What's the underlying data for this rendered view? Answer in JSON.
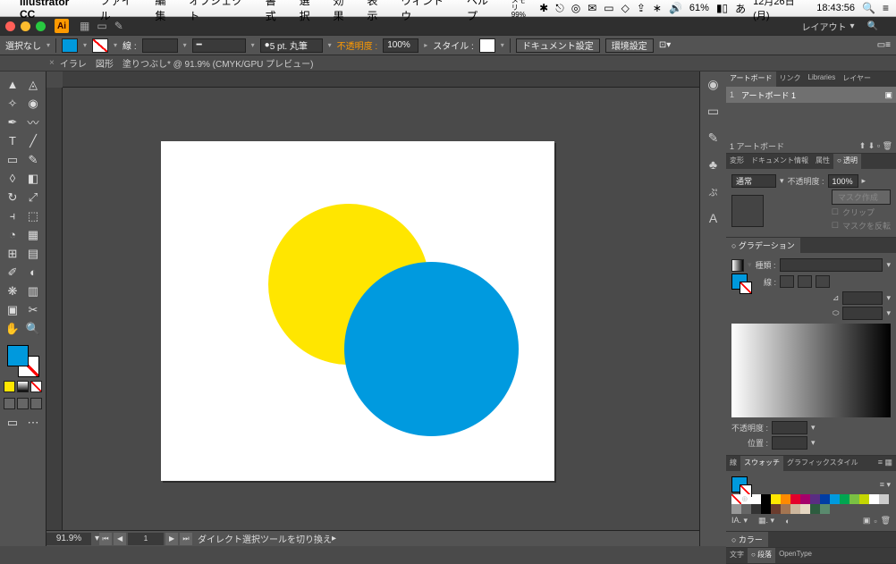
{
  "menubar": {
    "app": "Illustrator CC",
    "items": [
      "ファイル",
      "編集",
      "オブジェクト",
      "書式",
      "選択",
      "効果",
      "表示",
      "ウィンドウ",
      "ヘルプ"
    ],
    "memory_label": "メモリ",
    "memory_pct": "99%",
    "battery": "61%",
    "date": "12月26日(月)",
    "time": "18:43:56"
  },
  "titlebar": {
    "layout_label": "レイアウト"
  },
  "controlbar": {
    "selection": "選択なし",
    "stroke_label": "線 :",
    "stroke_weight": "",
    "stroke_style": "5 pt. 丸筆",
    "opacity_label": "不透明度 :",
    "opacity_value": "100%",
    "style_label": "スタイル :",
    "doc_setup": "ドキュメント設定",
    "env_setup": "環境設定"
  },
  "doc_tab": {
    "title": "イラレ　図形　塗りつぶし* @ 91.9% (CMYK/GPU プレビュー)"
  },
  "canvas": {
    "circle1_color": "#ffe600",
    "circle2_color": "#009adf"
  },
  "status": {
    "zoom": "91.9%",
    "hint": "ダイレクト選択ツールを切り換え"
  },
  "panels": {
    "artboard_tabs": [
      "アートボード",
      "リンク",
      "Libraries",
      "レイヤー"
    ],
    "artboards": [
      {
        "num": "1",
        "name": "アートボード 1"
      }
    ],
    "artboard_count": "1 アートボード",
    "transparency_tabs": [
      "変形",
      "ドキュメント情報",
      "属性",
      "○ 透明"
    ],
    "blend_mode": "通常",
    "tp_opacity_label": "不透明度 :",
    "tp_opacity_value": "100%",
    "mask_make": "マスク作成",
    "clip": "クリップ",
    "mask_invert": "マスクを反転",
    "gradient_tab": "○ グラデーション",
    "grad_type_label": "種類 :",
    "grad_s_label": "線 :",
    "grad_angle": "",
    "grad_ratio": "",
    "grad_op_label": "不透明度 :",
    "grad_pos_label": "位置 :",
    "swatch_tabs": [
      "線",
      "スウォッチ",
      "グラフィックスタイル"
    ],
    "color_tabs": [
      "○ カラー"
    ],
    "type_tabs": [
      "文字",
      "○ 段落",
      "OpenType"
    ]
  },
  "swatches": [
    "#ffffff",
    "#000000",
    "#ffe600",
    "#ff8a00",
    "#e4002b",
    "#a6006b",
    "#5a2d82",
    "#003da5",
    "#009adf",
    "#00a551",
    "#7ac143",
    "#c4d600",
    "#fff",
    "#ccc",
    "#999",
    "#666",
    "#333",
    "#000",
    "#6b3c2e",
    "#a47551",
    "#cdb79e",
    "#e6d7c3",
    "#2d5c3f",
    "#5a8a6e"
  ]
}
